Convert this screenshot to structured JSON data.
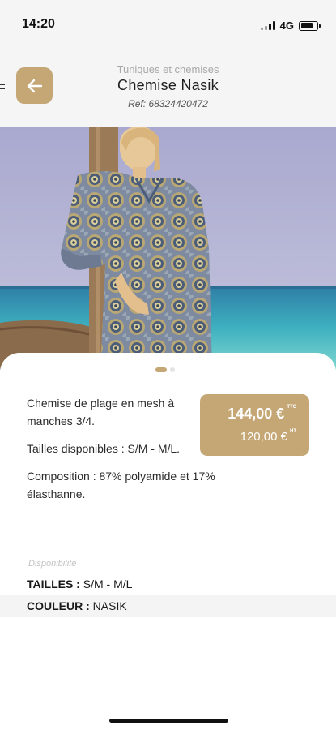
{
  "status_bar": {
    "time": "14:20",
    "network": "4G",
    "battery_level": 0.75
  },
  "header": {
    "category": "Tuniques et chemises",
    "title": "Chemise Nasik",
    "reference": "Ref: 68324420472",
    "back_icon": "arrow-left-icon",
    "menu_icon": "hamburger-menu-icon"
  },
  "carousel": {
    "current_index": 1,
    "total": 2
  },
  "product": {
    "description": [
      "Chemise de plage en mesh à manches 3/4.",
      "Tailles disponibles : S/M - M/L.",
      "Composition : 87% polyamide et 17% élasthanne."
    ],
    "price": {
      "ttc": "144,00 €",
      "ttc_suffix": "TTC",
      "ht": "120,00 €",
      "ht_suffix": "HT"
    },
    "availability": {
      "label": "Disponibilité",
      "sizes_key": "TAILLES :",
      "sizes_value": "S/M - M/L",
      "color_key": "COULEUR :",
      "color_value": "NASIK"
    }
  },
  "colors": {
    "accent": "#c4a775",
    "header_bg": "#f5f5f5"
  }
}
